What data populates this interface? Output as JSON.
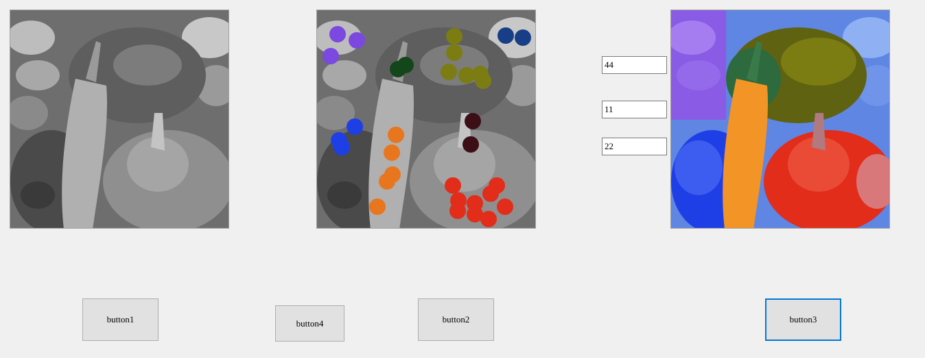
{
  "window": {
    "background": "#f0f0f0"
  },
  "images": {
    "original": {
      "name": "pepper-grayscale-picture",
      "style": "grayscale"
    },
    "marked": {
      "name": "pepper-seed-markers-picture",
      "style": "grayscale with colored seed dots",
      "marker_colors": [
        "#7b48e0",
        "#7b7d12",
        "#173e86",
        "#14461b",
        "#1f3fe6",
        "#e8761e",
        "#3c0f17",
        "#e12d1a"
      ]
    },
    "segmented": {
      "name": "pepper-colorized-picture",
      "style": "colorized segmentation result",
      "region_colors": [
        "#7b48e0",
        "#7b7d12",
        "#5f86e2",
        "#14461b",
        "#1f3fe6",
        "#f39426",
        "#3c0f17",
        "#e12d1a"
      ]
    }
  },
  "textboxes": [
    {
      "value": "44"
    },
    {
      "value": "11"
    },
    {
      "value": "22"
    }
  ],
  "buttons": {
    "button1": "button1",
    "button4": "button4",
    "button2": "button2",
    "button3": "button3"
  },
  "accent": "#0078d7"
}
